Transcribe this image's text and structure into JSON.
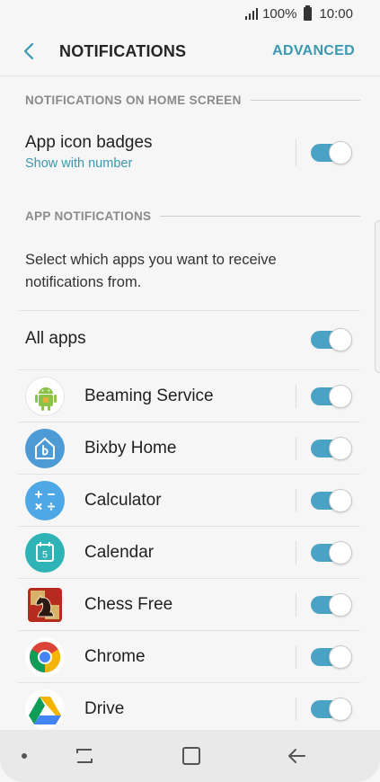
{
  "status": {
    "battery": "100%",
    "time": "10:00"
  },
  "appbar": {
    "title": "NOTIFICATIONS",
    "advanced_label": "ADVANCED"
  },
  "home_section": {
    "header": "NOTIFICATIONS ON HOME SCREEN",
    "badges_title": "App icon badges",
    "badges_subtitle": "Show with number",
    "badges_enabled": true
  },
  "app_section": {
    "header": "APP NOTIFICATIONS",
    "description": "Select which apps you want to receive notifications from.",
    "all_apps_label": "All apps",
    "all_apps_enabled": true,
    "apps": [
      {
        "label": "Beaming Service",
        "icon": "android-robot-icon",
        "enabled": true
      },
      {
        "label": "Bixby Home",
        "icon": "bixby-home-icon",
        "enabled": true
      },
      {
        "label": "Calculator",
        "icon": "calculator-icon",
        "enabled": true
      },
      {
        "label": "Calendar",
        "icon": "calendar-icon",
        "enabled": true
      },
      {
        "label": "Chess Free",
        "icon": "chess-knight-icon",
        "enabled": true
      },
      {
        "label": "Chrome",
        "icon": "chrome-icon",
        "enabled": true
      },
      {
        "label": "Drive",
        "icon": "google-drive-icon",
        "enabled": true
      }
    ]
  },
  "calendar_icon_number": "5",
  "colors": {
    "accent": "#3c98b0",
    "toggle_on": "#4aa3c5",
    "background": "#f6f6f6"
  }
}
